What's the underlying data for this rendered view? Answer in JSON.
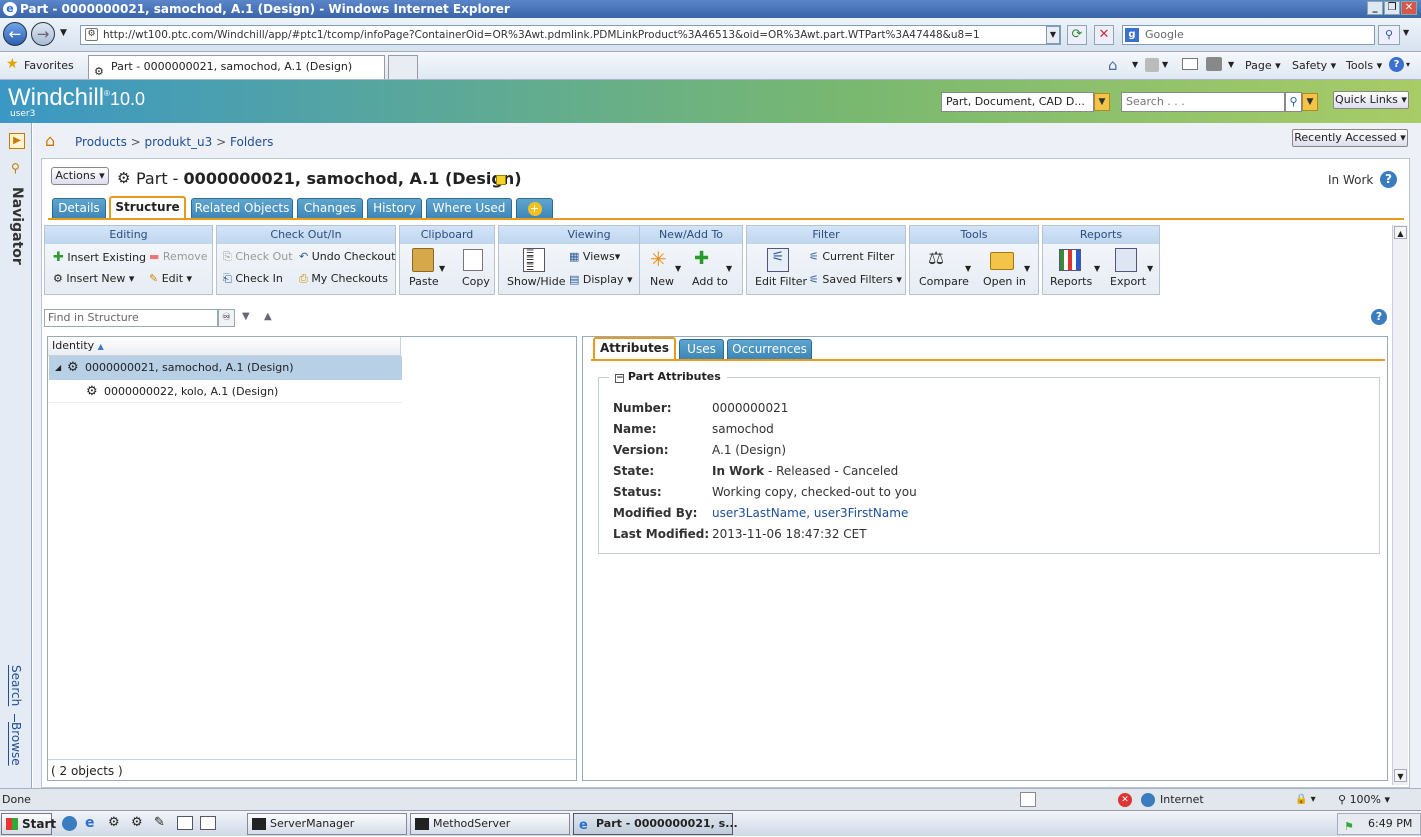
{
  "window": {
    "title": "Part - 0000000021, samochod, A.1 (Design) - Windows Internet Explorer"
  },
  "browser": {
    "url": "http://wt100.ptc.com/Windchill/app/#ptc1/tcomp/infoPage?ContainerOid=OR%3Awt.pdmlink.PDMLinkProduct%3A46513&oid=OR%3Awt.part.WTPart%3A47448&u8=1",
    "search_placeholder": "Google",
    "favorites": "Favorites",
    "tab_title": "Part - 0000000021, samochod, A.1 (Design)",
    "menu": {
      "page": "Page",
      "safety": "Safety",
      "tools": "Tools"
    }
  },
  "header": {
    "logo": "Windchill",
    "version": "10.0",
    "user": "user3",
    "type_filter": "Part, Document, CAD D...",
    "search_placeholder": "Search . . .",
    "quick_links": "Quick Links"
  },
  "nav": {
    "navigator": "Navigator",
    "search": "Search",
    "browse": "Browse"
  },
  "breadcrumb": {
    "products": "Products",
    "sep": ">",
    "product": "produkt_u3",
    "folders": "Folders"
  },
  "recently_accessed": "Recently Accessed",
  "page": {
    "actions": "Actions",
    "type": "Part -",
    "title": "0000000021, samochod, A.1 (Design)",
    "state": "In Work",
    "tabs": [
      "Details",
      "Structure",
      "Related Objects",
      "Changes",
      "History",
      "Where Used"
    ]
  },
  "toolbar": {
    "editing": {
      "label": "Editing",
      "insert_existing": "Insert Existing",
      "remove": "Remove",
      "insert_new": "Insert New",
      "edit": "Edit"
    },
    "checkout": {
      "label": "Check Out/In",
      "check_out": "Check Out",
      "undo_checkout": "Undo Checkout",
      "check_in": "Check In",
      "my_checkouts": "My Checkouts"
    },
    "clipboard": {
      "label": "Clipboard",
      "paste": "Paste",
      "copy": "Copy"
    },
    "viewing": {
      "label": "Viewing",
      "show_hide": "Show/Hide",
      "views": "Views",
      "display": "Display"
    },
    "newadd": {
      "label": "New/Add To",
      "new": "New",
      "add_to": "Add to"
    },
    "filter": {
      "label": "Filter",
      "edit_filter": "Edit Filter",
      "current_filter": "Current Filter",
      "saved_filters": "Saved Filters"
    },
    "tools": {
      "label": "Tools",
      "compare": "Compare",
      "open_in": "Open in"
    },
    "reports": {
      "label": "Reports",
      "reports": "Reports",
      "export": "Export"
    }
  },
  "structure": {
    "find_placeholder": "Find in Structure",
    "column": "Identity",
    "rows": [
      "0000000021, samochod, A.1 (Design)",
      "0000000022, kolo, A.1 (Design)"
    ],
    "footer": "( 2 objects )"
  },
  "attributes": {
    "tabs": [
      "Attributes",
      "Uses",
      "Occurrences"
    ],
    "section": "Part Attributes",
    "number_label": "Number:",
    "number": "0000000021",
    "name_label": "Name:",
    "name": "samochod",
    "version_label": "Version:",
    "version": "A.1 (Design)",
    "state_label": "State:",
    "state_bold": "In Work",
    "state_rest": " - Released - Canceled",
    "status_label": "Status:",
    "status": "Working copy, checked-out to you",
    "modified_by_label": "Modified By:",
    "modified_last": "user3LastName",
    "modified_sep": ", ",
    "modified_first": "user3FirstName",
    "last_modified_label": "Last Modified:",
    "last_modified": "2013-11-06 18:47:32 CET"
  },
  "statusbar": {
    "text": "Done",
    "zone": "Internet",
    "zoom": "100%"
  },
  "taskbar": {
    "start": "Start",
    "apps": [
      "ServerManager",
      "MethodServer",
      "Part - 0000000021, s..."
    ],
    "clock": "6:49 PM"
  }
}
